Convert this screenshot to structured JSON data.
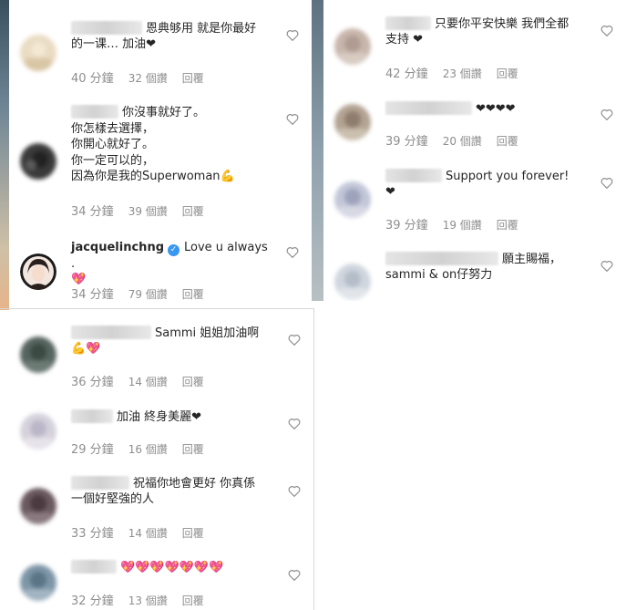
{
  "panel_a": {
    "comments": [
      {
        "text": "恩典够用 就是你最好\n的一课… 加油❤",
        "time": "40 分鐘",
        "likes": "32 個讚",
        "reply": "回覆"
      },
      {
        "text": "你沒事就好了。\n你怎樣去選擇，\n你開心就好了。\n你一定可以的，\n因為你是我的Superwoman💪",
        "time": "34 分鐘",
        "likes": "39 個讚",
        "reply": "回覆"
      },
      {
        "username": "jacquelinchng",
        "verified_mark": "✓",
        "text": "Love u always .\n💖",
        "time": "34 分鐘",
        "likes": "79 個讚",
        "reply": "回覆"
      }
    ]
  },
  "panel_b": {
    "comments": [
      {
        "text": "只要你平安快樂 我們全都\n支持 ❤",
        "time": "42 分鐘",
        "likes": "23 個讚",
        "reply": "回覆"
      },
      {
        "text": "❤❤❤❤",
        "time": "39 分鐘",
        "likes": "20 個讚",
        "reply": "回覆"
      },
      {
        "text": "Support you forever!\n❤",
        "time": "39 分鐘",
        "likes": "19 個讚",
        "reply": "回覆"
      },
      {
        "text": "願主賜福，\nsammi & on仔努力",
        "time": "",
        "likes": "",
        "reply": ""
      }
    ]
  },
  "panel_c": {
    "comments": [
      {
        "text": "Sammi 姐姐加油啊\n💪💖",
        "time": "36 分鐘",
        "likes": "14 個讚",
        "reply": "回覆"
      },
      {
        "text": "加油 終身美麗❤",
        "time": "29 分鐘",
        "likes": "16 個讚",
        "reply": "回覆"
      },
      {
        "text": "祝福你地會更好 你真係\n一個好堅強的人",
        "time": "33 分鐘",
        "likes": "14 個讚",
        "reply": "回覆"
      },
      {
        "text": "💖💖💖💖💖💖💖",
        "time": "32 分鐘",
        "likes": "13 個讚",
        "reply": "回覆"
      }
    ]
  },
  "colors": {
    "text": "#262626",
    "meta": "#8e8e8e",
    "verified": "#3897f0"
  },
  "icons": {
    "like": "heart-outline-icon"
  }
}
